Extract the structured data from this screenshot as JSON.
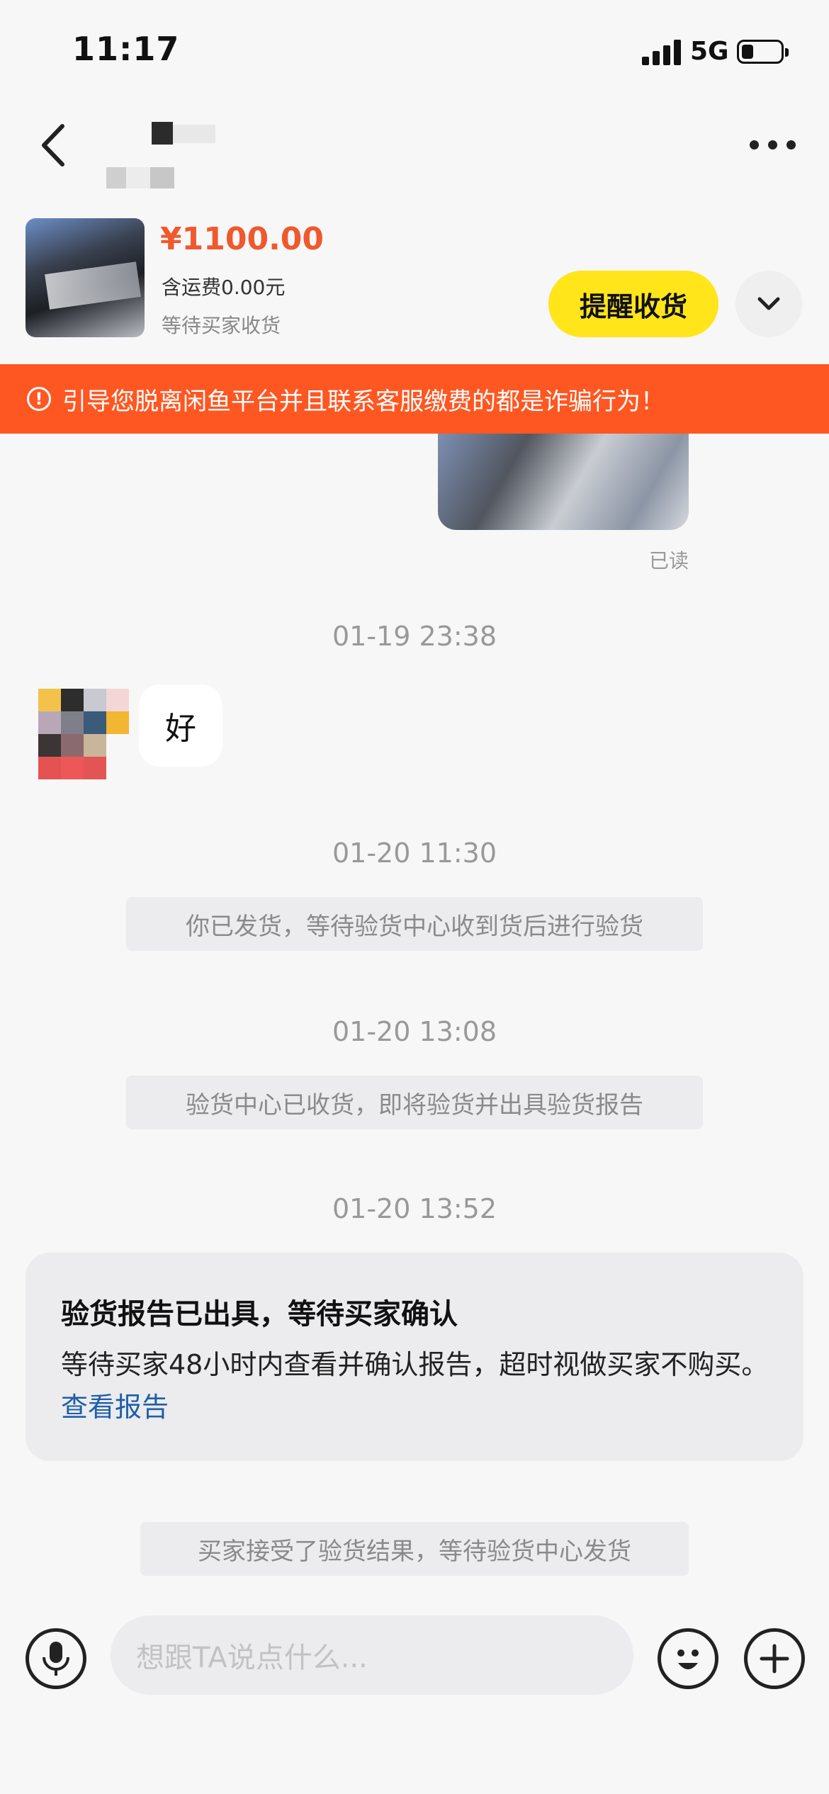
{
  "status_bar": {
    "time": "11:17",
    "network": "5G"
  },
  "header": {
    "back_icon": "chevron-left-icon",
    "more_icon": "more-dots-icon"
  },
  "product": {
    "price": "¥1100.00",
    "shipping": "含运费0.00元",
    "status": "等待买家收货",
    "remind_button": "提醒收货",
    "expand_icon": "chevron-down-icon"
  },
  "warning": {
    "text": "引导您脱离闲鱼平台并且联系客服缴费的都是诈骗行为！",
    "color": "#ff5722"
  },
  "messages": {
    "read_label": "已读",
    "ts1": "01-19 23:38",
    "incoming_text": "好",
    "ts2": "01-20 11:30",
    "sys1": "你已发货，等待验货中心收到货后进行验货",
    "ts3": "01-20 13:08",
    "sys2": "验货中心已收货，即将验货并出具验货报告",
    "ts4": "01-20 13:52",
    "report": {
      "title": "验货报告已出具，等待买家确认",
      "body": "等待买家48小时内查看并确认报告，超时视做买家不购买。",
      "link": "查看报告"
    },
    "sys3": "买家接受了验货结果，等待验货中心发货"
  },
  "input_bar": {
    "placeholder": "想跟TA说点什么...",
    "mic_icon": "microphone-icon",
    "emoji_icon": "emoji-icon",
    "plus_icon": "plus-icon"
  },
  "colors": {
    "accent_yellow": "#ffe51a",
    "price_orange": "#f0582d",
    "link_blue": "#1f5fa8"
  }
}
